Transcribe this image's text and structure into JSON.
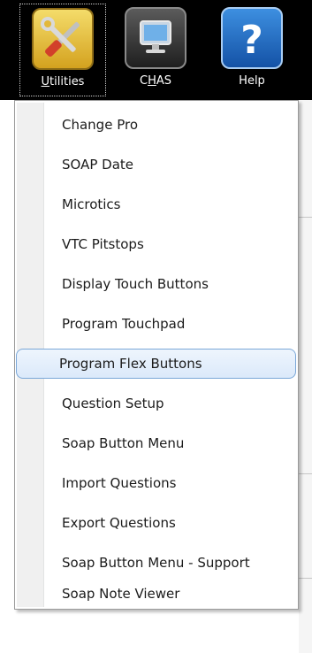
{
  "toolbar": {
    "buttons": [
      {
        "label": "Utilities",
        "icon": "tools-icon",
        "accel": "U"
      },
      {
        "label": "CHAS",
        "icon": "monitor-icon",
        "accel": "H"
      },
      {
        "label": "Help",
        "icon": "question-mark-icon"
      }
    ]
  },
  "menu": {
    "items": [
      "Change Pro",
      "SOAP Date",
      "Microtics",
      "VTC Pitstops",
      "Display Touch Buttons",
      "Program Touchpad",
      "Program Flex Buttons",
      "Question Setup",
      "Soap Button Menu",
      "Import Questions",
      "Export Questions",
      "Soap Button Menu - Support",
      "Soap Note Viewer"
    ],
    "hovered_item": "Program Flex Buttons"
  },
  "colors": {
    "toolbar_bg": "#000000",
    "hover_border": "#7aa7d8",
    "utilities_tile": "#e8c24a",
    "help_tile": "#2a74cf"
  }
}
